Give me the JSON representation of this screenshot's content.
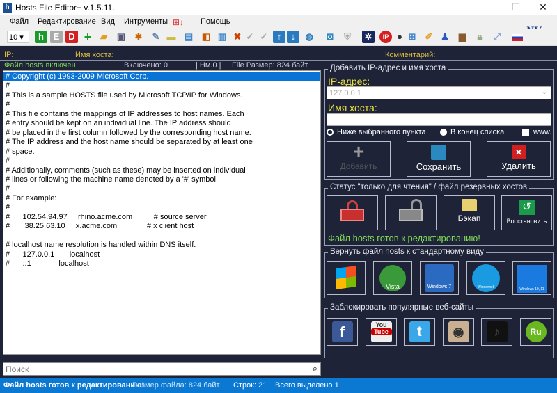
{
  "window": {
    "title": "Hosts File Editor+ v.1.5.11.",
    "minimize": "—",
    "maximize": "☐",
    "close": "✕"
  },
  "menu": [
    "Файл",
    "Редактирование",
    "Вид",
    "Интрументы",
    "Помощь"
  ],
  "toolbar": {
    "font_size": "10",
    "h": "h",
    "e": "E",
    "d": "D"
  },
  "header": {
    "ip": "IP:",
    "host": "Имя хоста:",
    "comment": "Комментарий:"
  },
  "info": {
    "enabled_status": "Файл hosts включен",
    "enabled_count": "Включено: 0",
    "nm": "| Нм.0 |",
    "file_size": "File Размер: 824 байт"
  },
  "editor": {
    "lines": [
      "# Copyright (c) 1993-2009 Microsoft Corp.",
      "#",
      "# This is a sample HOSTS file used by Microsoft TCP/IP for Windows.",
      "#",
      "# This file contains the mappings of IP addresses to host names. Each",
      "# entry should be kept on an individual line. The IP address should",
      "# be placed in the first column followed by the corresponding host name.",
      "# The IP address and the host name should be separated by at least one",
      "# space.",
      "#",
      "# Additionally, comments (such as these) may be inserted on individual",
      "# lines or following the machine name denoted by a '#' symbol.",
      "#",
      "# For example:",
      "#",
      "#      102.54.94.97     rhino.acme.com          # source server",
      "#       38.25.63.10     x.acme.com              # x client host",
      "",
      "# localhost name resolution is handled within DNS itself.",
      "#\t127.0.0.1       localhost",
      "#\t::1             localhost"
    ]
  },
  "search": {
    "placeholder": "Поиск"
  },
  "add_group": {
    "title": "Добавить IP-адрес и имя хоста",
    "ip_label": "IP-адрес:",
    "ip_value": "127.0.0.1",
    "host_label": "Имя хоста:",
    "host_value": "",
    "radio_below": "Ниже выбранного пункта",
    "radio_end": "В конец списка",
    "www": "www.",
    "add": "Добавить",
    "save": "Сохранить",
    "delete": "Удалить"
  },
  "status_group": {
    "title": "Статус \"только для чтения\" / файл резервных хостов",
    "backup": "Бэкап",
    "restore": "Восстановить",
    "message": "Файл hosts готов к редактированию!"
  },
  "restore_group": {
    "title": "Вернуть файл hosts к стандартному виду",
    "vista": "Vista",
    "win7": "Windows 7",
    "win8": "Windows 8",
    "win1011": "Windows 10, 11"
  },
  "block_group": {
    "title": "Заблокировать популярные веб-сайты",
    "facebook": "f",
    "youtube_top": "You",
    "youtube_bottom": "Tube",
    "ru": "Ru"
  },
  "statusbar": {
    "message": "Файл hosts готов к редактированию!",
    "size": "Размер файла:  824 байт",
    "lines": "Строк: 21",
    "selected": "Всего выделено 1"
  },
  "colors": {
    "bg": "#1e2338",
    "accent": "#0b78d2",
    "green": "#7ed957",
    "yellow": "#e8e040"
  }
}
